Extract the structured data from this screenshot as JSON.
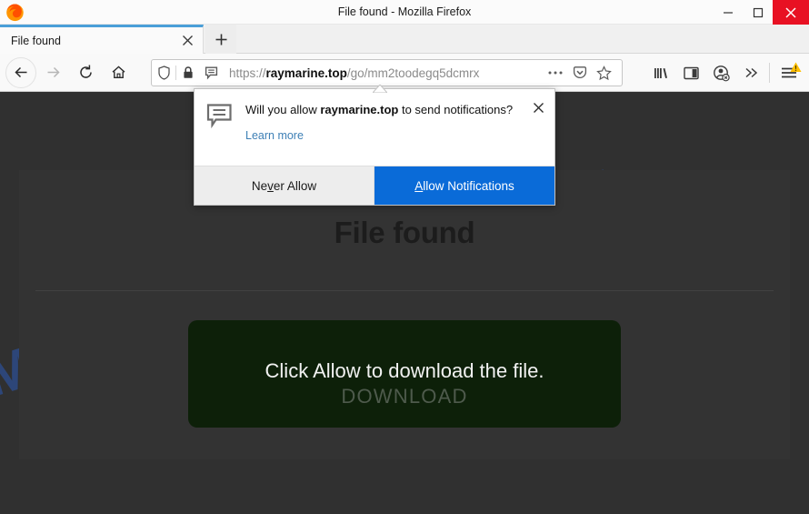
{
  "window": {
    "title": "File found - Mozilla Firefox",
    "controls": {
      "minimize": "minimize-icon",
      "maximize": "maximize-icon",
      "close": "close-icon"
    },
    "close_color": "#e81123"
  },
  "tabs": {
    "active": {
      "label": "File found",
      "close_label": "×"
    },
    "new_tab_label": "+"
  },
  "toolbar": {
    "back": "back-icon",
    "forward": "forward-icon",
    "reload": "reload-icon",
    "home": "home-icon",
    "library": "library-icon",
    "sidebar": "sidebar-icon",
    "account": "account-icon",
    "overflow": "chevrons-right-icon",
    "menu": "hamburger-menu-icon"
  },
  "urlbar": {
    "shield_icon": "tracking-protection-shield-icon",
    "lock_icon": "padlock-icon",
    "permission_icon": "notification-bubble-icon",
    "scheme": "https://",
    "host": "raymarine.top",
    "path": "/go/mm2toodegq5dcmrx",
    "full_url": "https://raymarine.top/go/mm2toodegq5dcmrx",
    "page_actions_icon": "ellipsis-icon",
    "pocket_icon": "pocket-icon",
    "bookmark_icon": "star-icon"
  },
  "popup": {
    "icon": "notification-bubble-icon",
    "question_prefix": "Will you allow ",
    "question_domain": "raymarine.top",
    "question_suffix": " to send notifications?",
    "learn_more": "Learn more",
    "close_label": "✕",
    "never_allow": {
      "pre": "Ne",
      "accesskey": "v",
      "post": "er Allow"
    },
    "allow": {
      "accesskey": "A",
      "post": "llow Notifications"
    },
    "allow_color": "#0a6bd8"
  },
  "page": {
    "background_color": "#303030",
    "watermark": "MYANTISPYWARE.COM",
    "watermark_color": "#2d4b86",
    "title": "File found",
    "download_button": {
      "line1": "Click Allow to download the file.",
      "line2": "DOWNLOAD",
      "color": "#0d2009"
    }
  }
}
